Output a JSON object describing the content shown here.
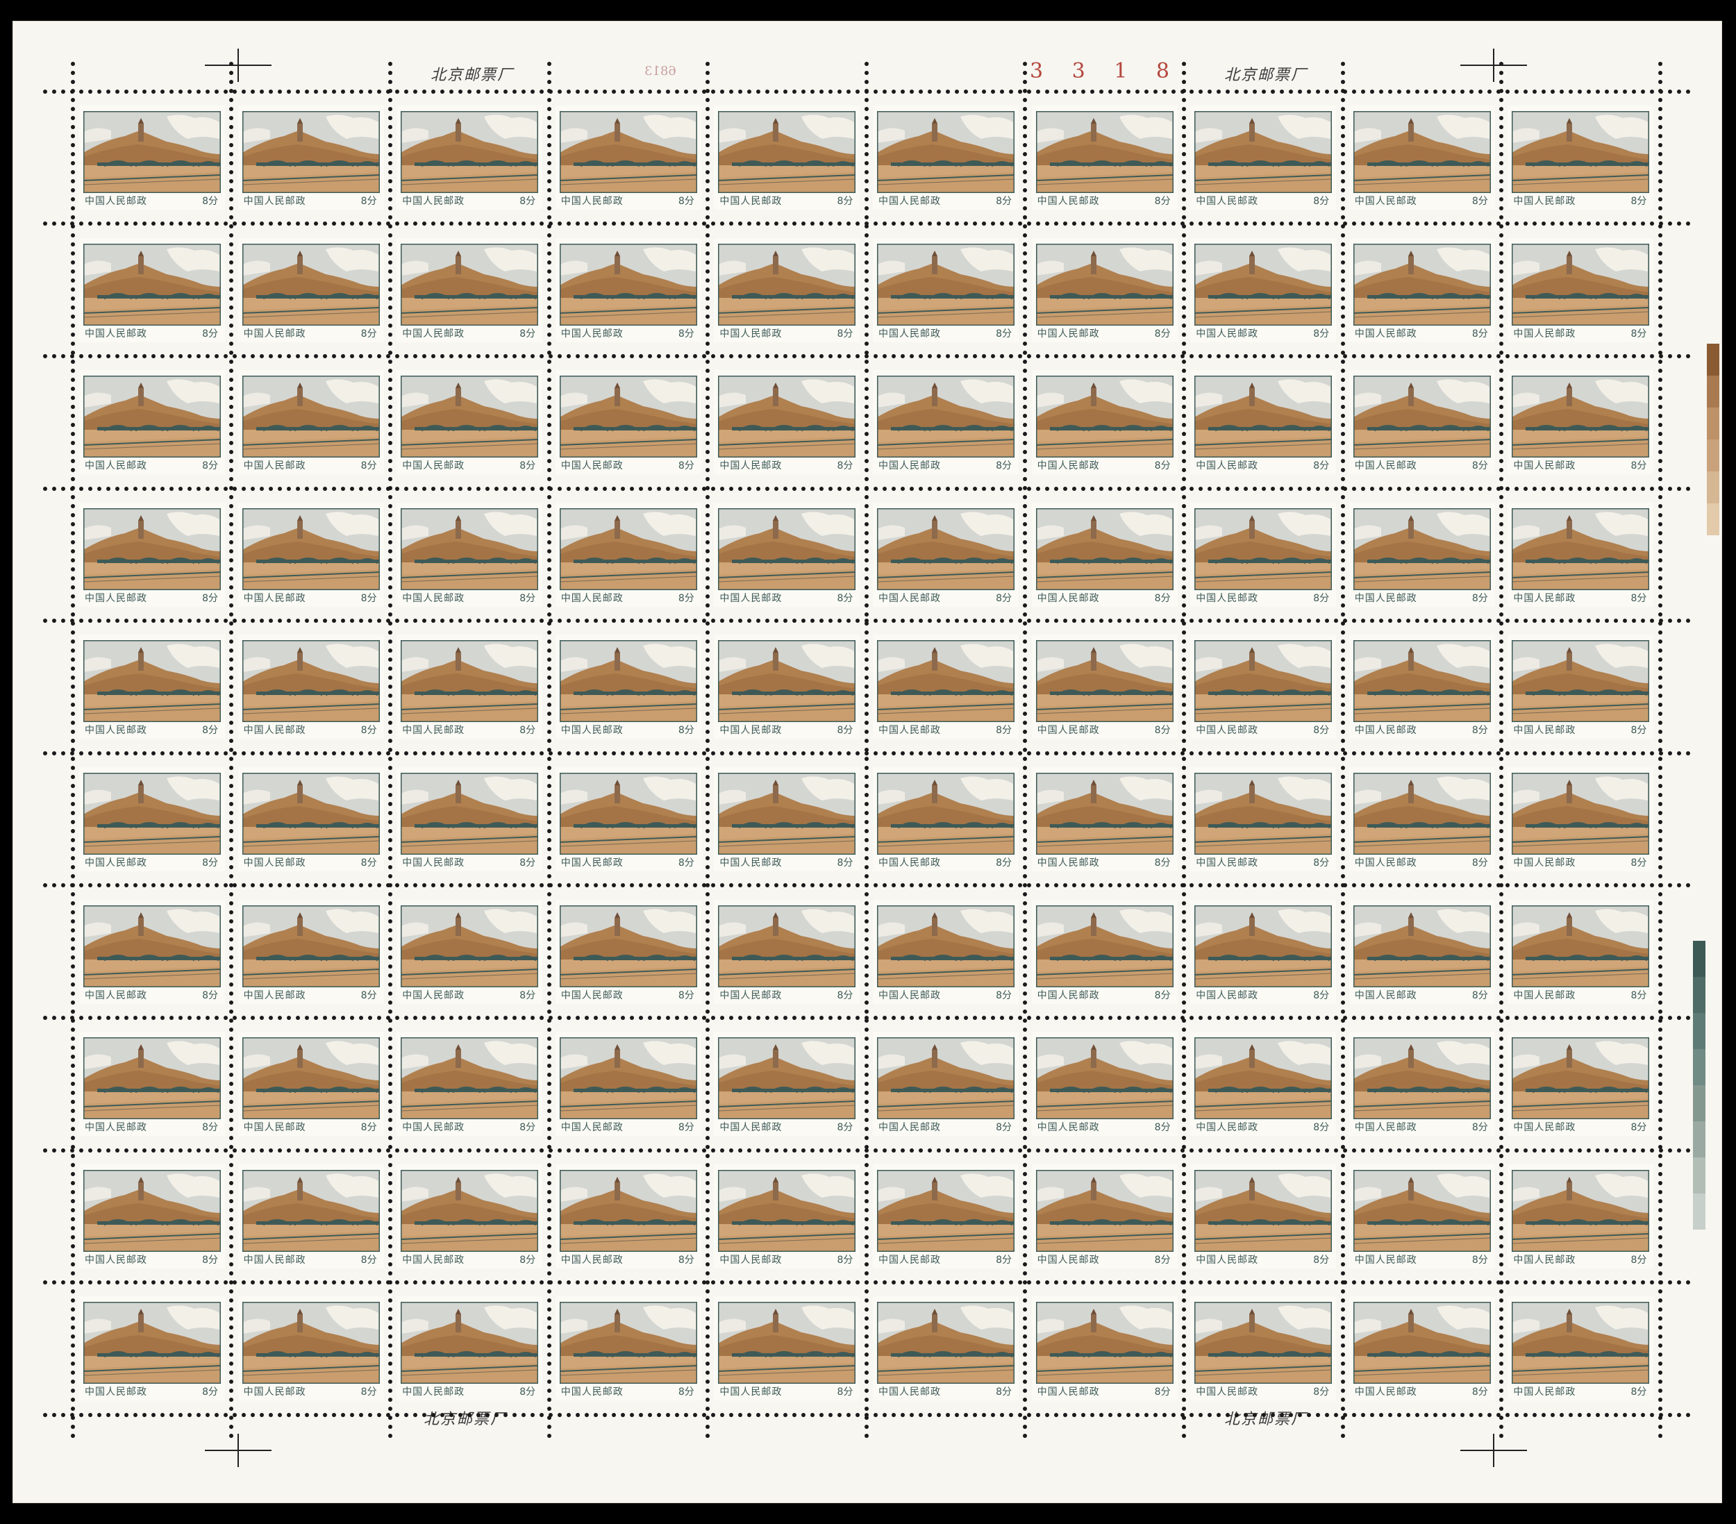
{
  "sheet": {
    "printer_imprint": "北京邮票厂",
    "sheet_number": "3 3 1 8",
    "mirrored_plate_code": "6813"
  },
  "stamp": {
    "inscription": "中国人民邮政",
    "denomination": "8分",
    "rows": 10,
    "columns": 10
  },
  "color_guides": {
    "brown": [
      "#8a5a32",
      "#a97a4f",
      "#bd9268",
      "#c9a27c",
      "#d6b793",
      "#e2caab"
    ],
    "green": [
      "#3d5a55",
      "#4f6c66",
      "#5f7b75",
      "#708a84",
      "#83988f",
      "#9aa9a2",
      "#b2bdb6",
      "#c7cfca"
    ]
  },
  "colors": {
    "sky": "#d4d6d2",
    "cloud": "#f3f0e8",
    "mountain": "#b0804f",
    "ground": "#d0a577",
    "bridge_green": "#3e5a57"
  }
}
